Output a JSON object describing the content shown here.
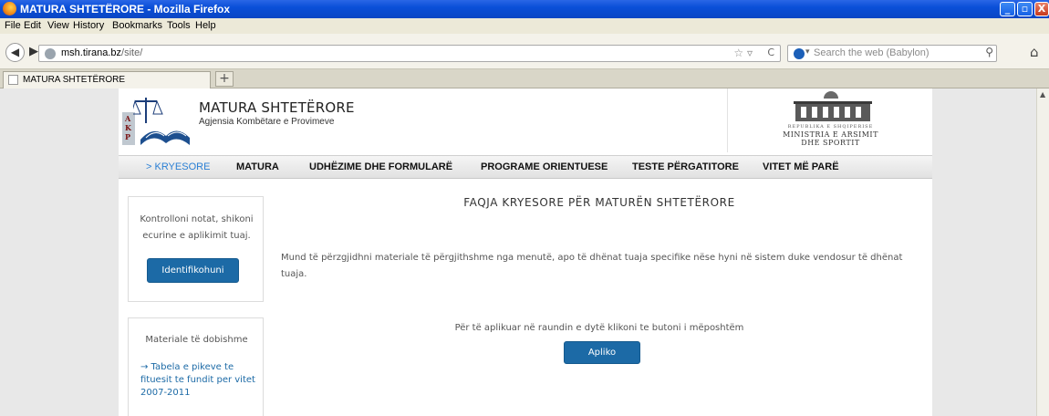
{
  "window": {
    "title": "MATURA SHTETËRORE - Mozilla Firefox",
    "buttons": {
      "minimize": "_",
      "restore": "▫",
      "close": "X"
    }
  },
  "menubar": {
    "items": [
      "File",
      "Edit",
      "View",
      "History",
      "Bookmarks",
      "Tools",
      "Help"
    ]
  },
  "navbar": {
    "back": "◀",
    "forward": "▶",
    "url_host": "msh.tirana.bz",
    "url_path": "/site/",
    "bookmark_star": "☆ ▿",
    "reload": "C",
    "search_placeholder": "Search the web (Babylon)",
    "search_engine_arrow": "▾",
    "search_icon": "⚲",
    "home_icon": "⌂"
  },
  "tabs": [
    {
      "title": "MATURA SHTETËRORE"
    }
  ],
  "newtab": "+",
  "site": {
    "logo_letters": "A\nK\nP",
    "title": "MATURA SHTETËRORE",
    "subtitle": "Agjensia Kombëtare e Provimeve",
    "ministry": {
      "line1": "REPUBLIKA E SHQIPERISE",
      "line2": "MINISTRIA E ARSIMIT",
      "line3": "DHE SPORTIT"
    }
  },
  "mainnav": [
    {
      "label": "> KRYESORE",
      "active": true
    },
    {
      "label": "MATURA"
    },
    {
      "label": "UDHËZIME DHE FORMULARË"
    },
    {
      "label": "PROGRAME ORIENTUESE"
    },
    {
      "label": "TESTE PËRGATITORE"
    },
    {
      "label": "VITET MË PARË"
    }
  ],
  "login_box": {
    "text": "Kontrolloni notat, shikoni ecurine e aplikimit tuaj.",
    "button": "Identifikohuni"
  },
  "materials_box": {
    "heading": "Materiale të dobishme",
    "link": "→ Tabela e pikeve te fituesit te fundit per vitet 2007-2011"
  },
  "content": {
    "title": "FAQJA KRYESORE PËR MATURËN SHTETËRORE",
    "intro": "Mund të përzgjidhni materiale të përgjithshme nga menutë, apo të dhënat tuaja specifike nëse hyni në sistem duke vendosur të dhënat tuaja.",
    "apply_text": "Për të aplikuar në raundin e dytë klikoni te butoni i mëposhtëm",
    "apply_button": "Apliko"
  }
}
